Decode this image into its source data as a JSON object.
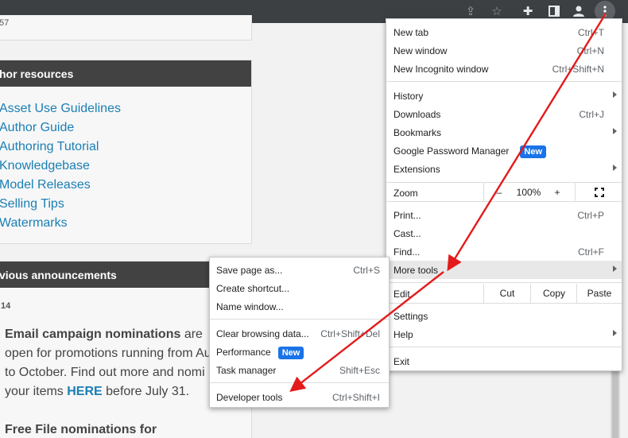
{
  "toolbar": {
    "icons": [
      "share-icon",
      "star-icon",
      "extensions-icon",
      "side-panel-icon",
      "profile-icon",
      "menu-icon"
    ]
  },
  "page": {
    "top_stub": "57",
    "author_resources": {
      "heading": "hor resources",
      "links": [
        "Asset Use Guidelines",
        "Author Guide",
        "Authoring Tutorial",
        "Knowledgebase",
        "Model Releases",
        "Selling Tips",
        "Watermarks"
      ]
    },
    "announcements": {
      "heading": "vious announcements",
      "date": "14",
      "p1_bold": "Email campaign nominations",
      "p1_rest_line1": " are",
      "p1_line2": "open for promotions running from Au",
      "p1_line3": "to October. Find out more and nomi",
      "p1_line4_pre": "your items ",
      "p1_link": "HERE",
      "p1_line4_post": " before July 31.",
      "p2_bold": "Free File nominations for"
    }
  },
  "menu": {
    "new_tab": {
      "label": "New tab",
      "shortcut": "Ctrl+T"
    },
    "new_window": {
      "label": "New window",
      "shortcut": "Ctrl+N"
    },
    "new_incognito": {
      "label": "New Incognito window",
      "shortcut": "Ctrl+Shift+N"
    },
    "history": {
      "label": "History"
    },
    "downloads": {
      "label": "Downloads",
      "shortcut": "Ctrl+J"
    },
    "bookmarks": {
      "label": "Bookmarks"
    },
    "password_manager": {
      "label": "Google Password Manager",
      "badge": "New"
    },
    "extensions": {
      "label": "Extensions"
    },
    "zoom": {
      "label": "Zoom",
      "minus": "–",
      "level": "100%",
      "plus": "+"
    },
    "print": {
      "label": "Print...",
      "shortcut": "Ctrl+P"
    },
    "cast": {
      "label": "Cast..."
    },
    "find": {
      "label": "Find...",
      "shortcut": "Ctrl+F"
    },
    "more_tools": {
      "label": "More tools"
    },
    "edit": {
      "label": "Edit",
      "cut": "Cut",
      "copy": "Copy",
      "paste": "Paste"
    },
    "settings": {
      "label": "Settings"
    },
    "help": {
      "label": "Help"
    },
    "exit": {
      "label": "Exit"
    }
  },
  "submenu": {
    "save_page": {
      "label": "Save page as...",
      "shortcut": "Ctrl+S"
    },
    "create_shortcut": {
      "label": "Create shortcut..."
    },
    "name_window": {
      "label": "Name window..."
    },
    "clear_browsing": {
      "label": "Clear browsing data...",
      "shortcut": "Ctrl+Shift+Del"
    },
    "performance": {
      "label": "Performance",
      "badge": "New"
    },
    "task_manager": {
      "label": "Task manager",
      "shortcut": "Shift+Esc"
    },
    "developer_tools": {
      "label": "Developer tools",
      "shortcut": "Ctrl+Shift+I"
    }
  },
  "colors": {
    "annotation_arrow": "#e31b1b",
    "badge": "#1a73e8",
    "link": "#1a7fb5"
  }
}
